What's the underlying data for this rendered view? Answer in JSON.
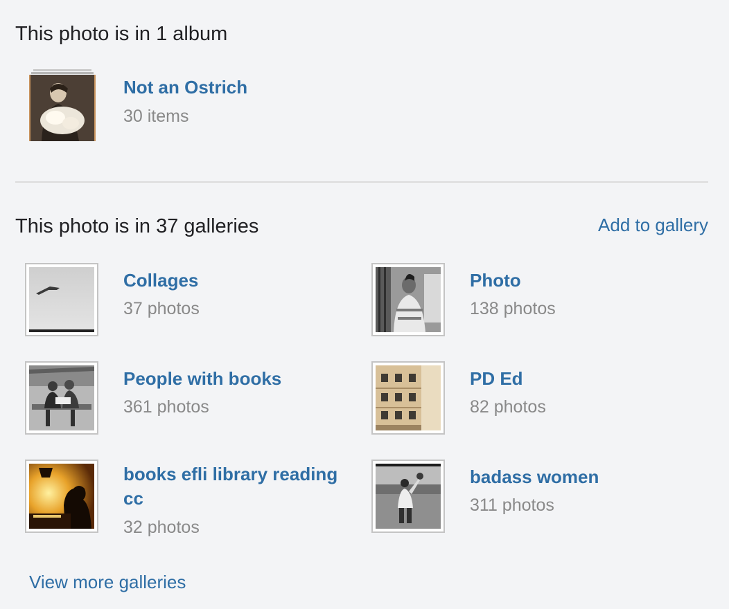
{
  "albums_section": {
    "title": "This photo is in 1 album",
    "album": {
      "title": "Not an Ostrich",
      "count": "30 items"
    }
  },
  "galleries_section": {
    "title": "This photo is in 37 galleries",
    "add_label": "Add to gallery",
    "galleries": [
      {
        "title": "Collages",
        "count": "37 photos"
      },
      {
        "title": "Photo",
        "count": "138 photos"
      },
      {
        "title": "People with books",
        "count": "361 photos"
      },
      {
        "title": "PD Ed",
        "count": "82 photos"
      },
      {
        "title": "books efli library reading cc",
        "count": "32 photos"
      },
      {
        "title": "badass women",
        "count": "311 photos"
      }
    ],
    "view_more_label": "View more galleries"
  },
  "colors": {
    "link": "#2f6ea5",
    "muted": "#898989",
    "text": "#212124",
    "background": "#f3f4f6"
  }
}
